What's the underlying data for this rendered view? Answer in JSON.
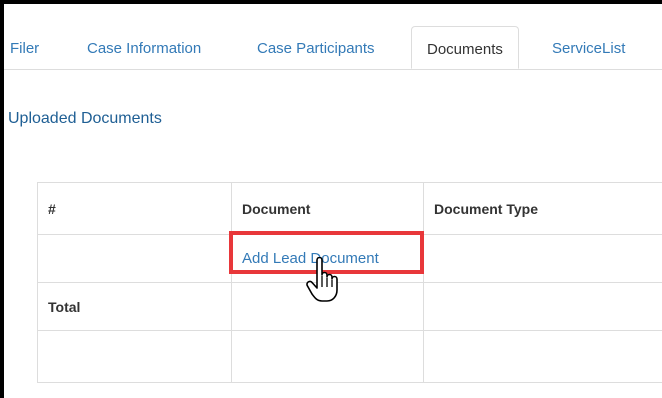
{
  "tabs": [
    {
      "label": "Filer"
    },
    {
      "label": "Case Information"
    },
    {
      "label": "Case Participants"
    },
    {
      "label": "Documents",
      "active": true
    },
    {
      "label": "ServiceList"
    }
  ],
  "section": {
    "title": "Uploaded Documents"
  },
  "table": {
    "headers": [
      "#",
      "Document",
      "Document Type"
    ],
    "add_link_label": "Add Lead Document",
    "total_label": "Total"
  },
  "colors": {
    "link": "#337ab7",
    "highlight": "#e8373a"
  },
  "icons": {
    "cursor": "hand-pointer-icon"
  }
}
